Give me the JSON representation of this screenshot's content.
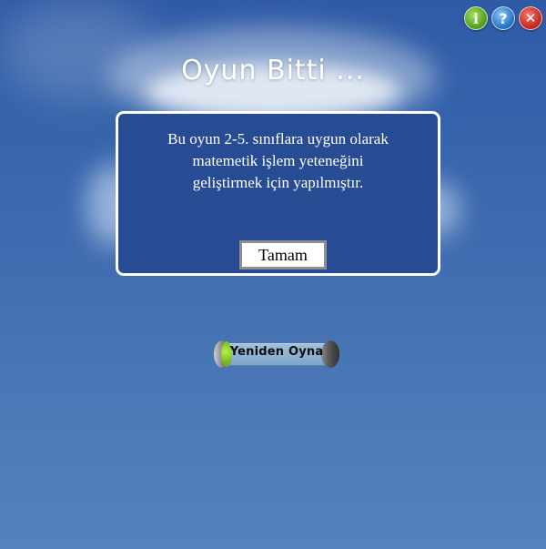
{
  "toolbar": {
    "info_label": "i",
    "help_label": "?",
    "close_label": "✕"
  },
  "title": "Oyun Bitti ...",
  "dialog": {
    "message_lines": [
      "Bu oyun 2-5. sınıflara uygun olarak",
      "matemetik işlem yeteneğini",
      "geliştirmek için yapılmıştır."
    ],
    "ok_label": "Tamam"
  },
  "replay": {
    "label": "Yeniden Oyna"
  },
  "icons": [
    "info-icon",
    "help-icon",
    "close-icon"
  ],
  "colors": {
    "background": "#3f6cb0",
    "dialog_background": "#284c93",
    "dialog_border": "#ffffff",
    "info": "#4d9a1d",
    "help": "#1f6fc2",
    "close": "#c0221b"
  }
}
